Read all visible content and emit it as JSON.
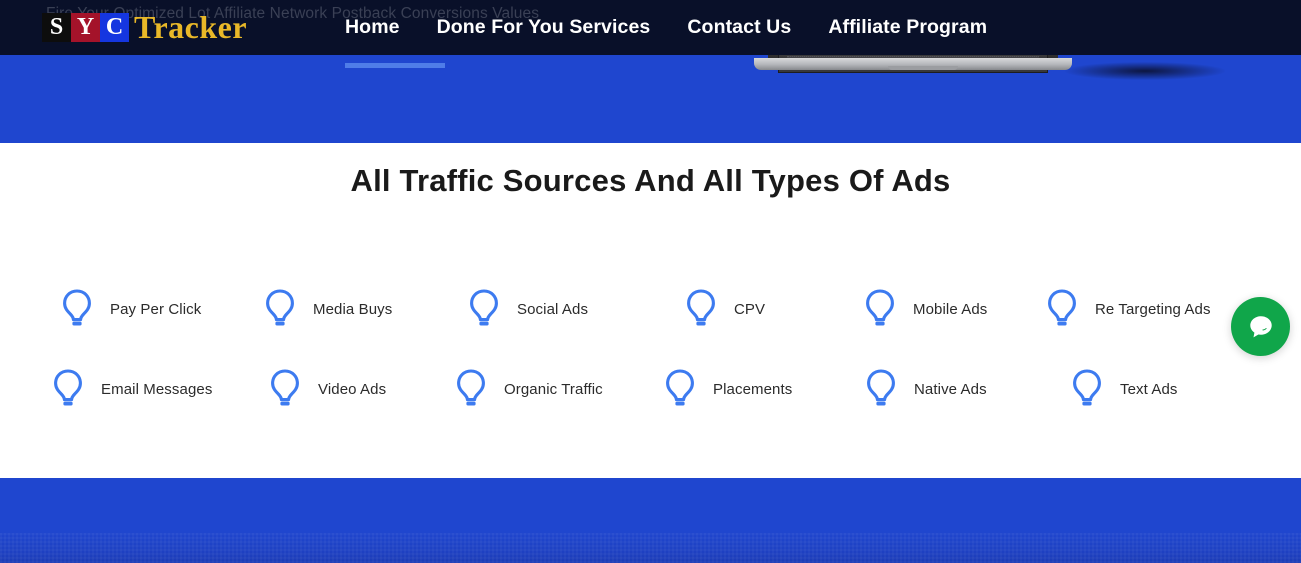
{
  "header": {
    "tagline": "Fire Your Optimized Lot Affiliate Network Postback Conversions Values",
    "logo": {
      "letter1": "S",
      "letter2": "Y",
      "letter3": "C",
      "word": "Tracker",
      "color1": "#0d0d0d",
      "color2": "#a4132a",
      "color3": "#1536e0",
      "word_color": "#e9b828"
    },
    "nav": [
      {
        "label": "Home",
        "active": true
      },
      {
        "label": "Done For You Services",
        "active": false
      },
      {
        "label": "Contact Us",
        "active": false
      },
      {
        "label": "Affiliate Program",
        "active": false
      }
    ],
    "bar_color": "#091029",
    "hero_color": "#1f46cf",
    "active_underline_color": "#4f7de8"
  },
  "main": {
    "title": "All Traffic Sources And All Types Of Ads",
    "icon_color": "#3d7bf0",
    "rows": [
      [
        {
          "label": "Pay Per Click",
          "icon": "lightbulb-icon"
        },
        {
          "label": "Media Buys",
          "icon": "lightbulb-icon"
        },
        {
          "label": "Social Ads",
          "icon": "lightbulb-icon"
        },
        {
          "label": "CPV",
          "icon": "lightbulb-icon"
        },
        {
          "label": "Mobile Ads",
          "icon": "lightbulb-icon"
        },
        {
          "label": "Re Targeting Ads",
          "icon": "lightbulb-icon"
        }
      ],
      [
        {
          "label": "Email Messages",
          "icon": "lightbulb-icon"
        },
        {
          "label": "Video Ads",
          "icon": "lightbulb-icon"
        },
        {
          "label": "Organic Traffic",
          "icon": "lightbulb-icon"
        },
        {
          "label": "Placements",
          "icon": "lightbulb-icon"
        },
        {
          "label": "Native Ads",
          "icon": "lightbulb-icon"
        },
        {
          "label": "Text Ads",
          "icon": "lightbulb-icon"
        }
      ]
    ]
  },
  "chat": {
    "icon": "chat-bubble-icon",
    "color": "#10a64a"
  },
  "footer": {
    "color": "#1f46cf"
  }
}
